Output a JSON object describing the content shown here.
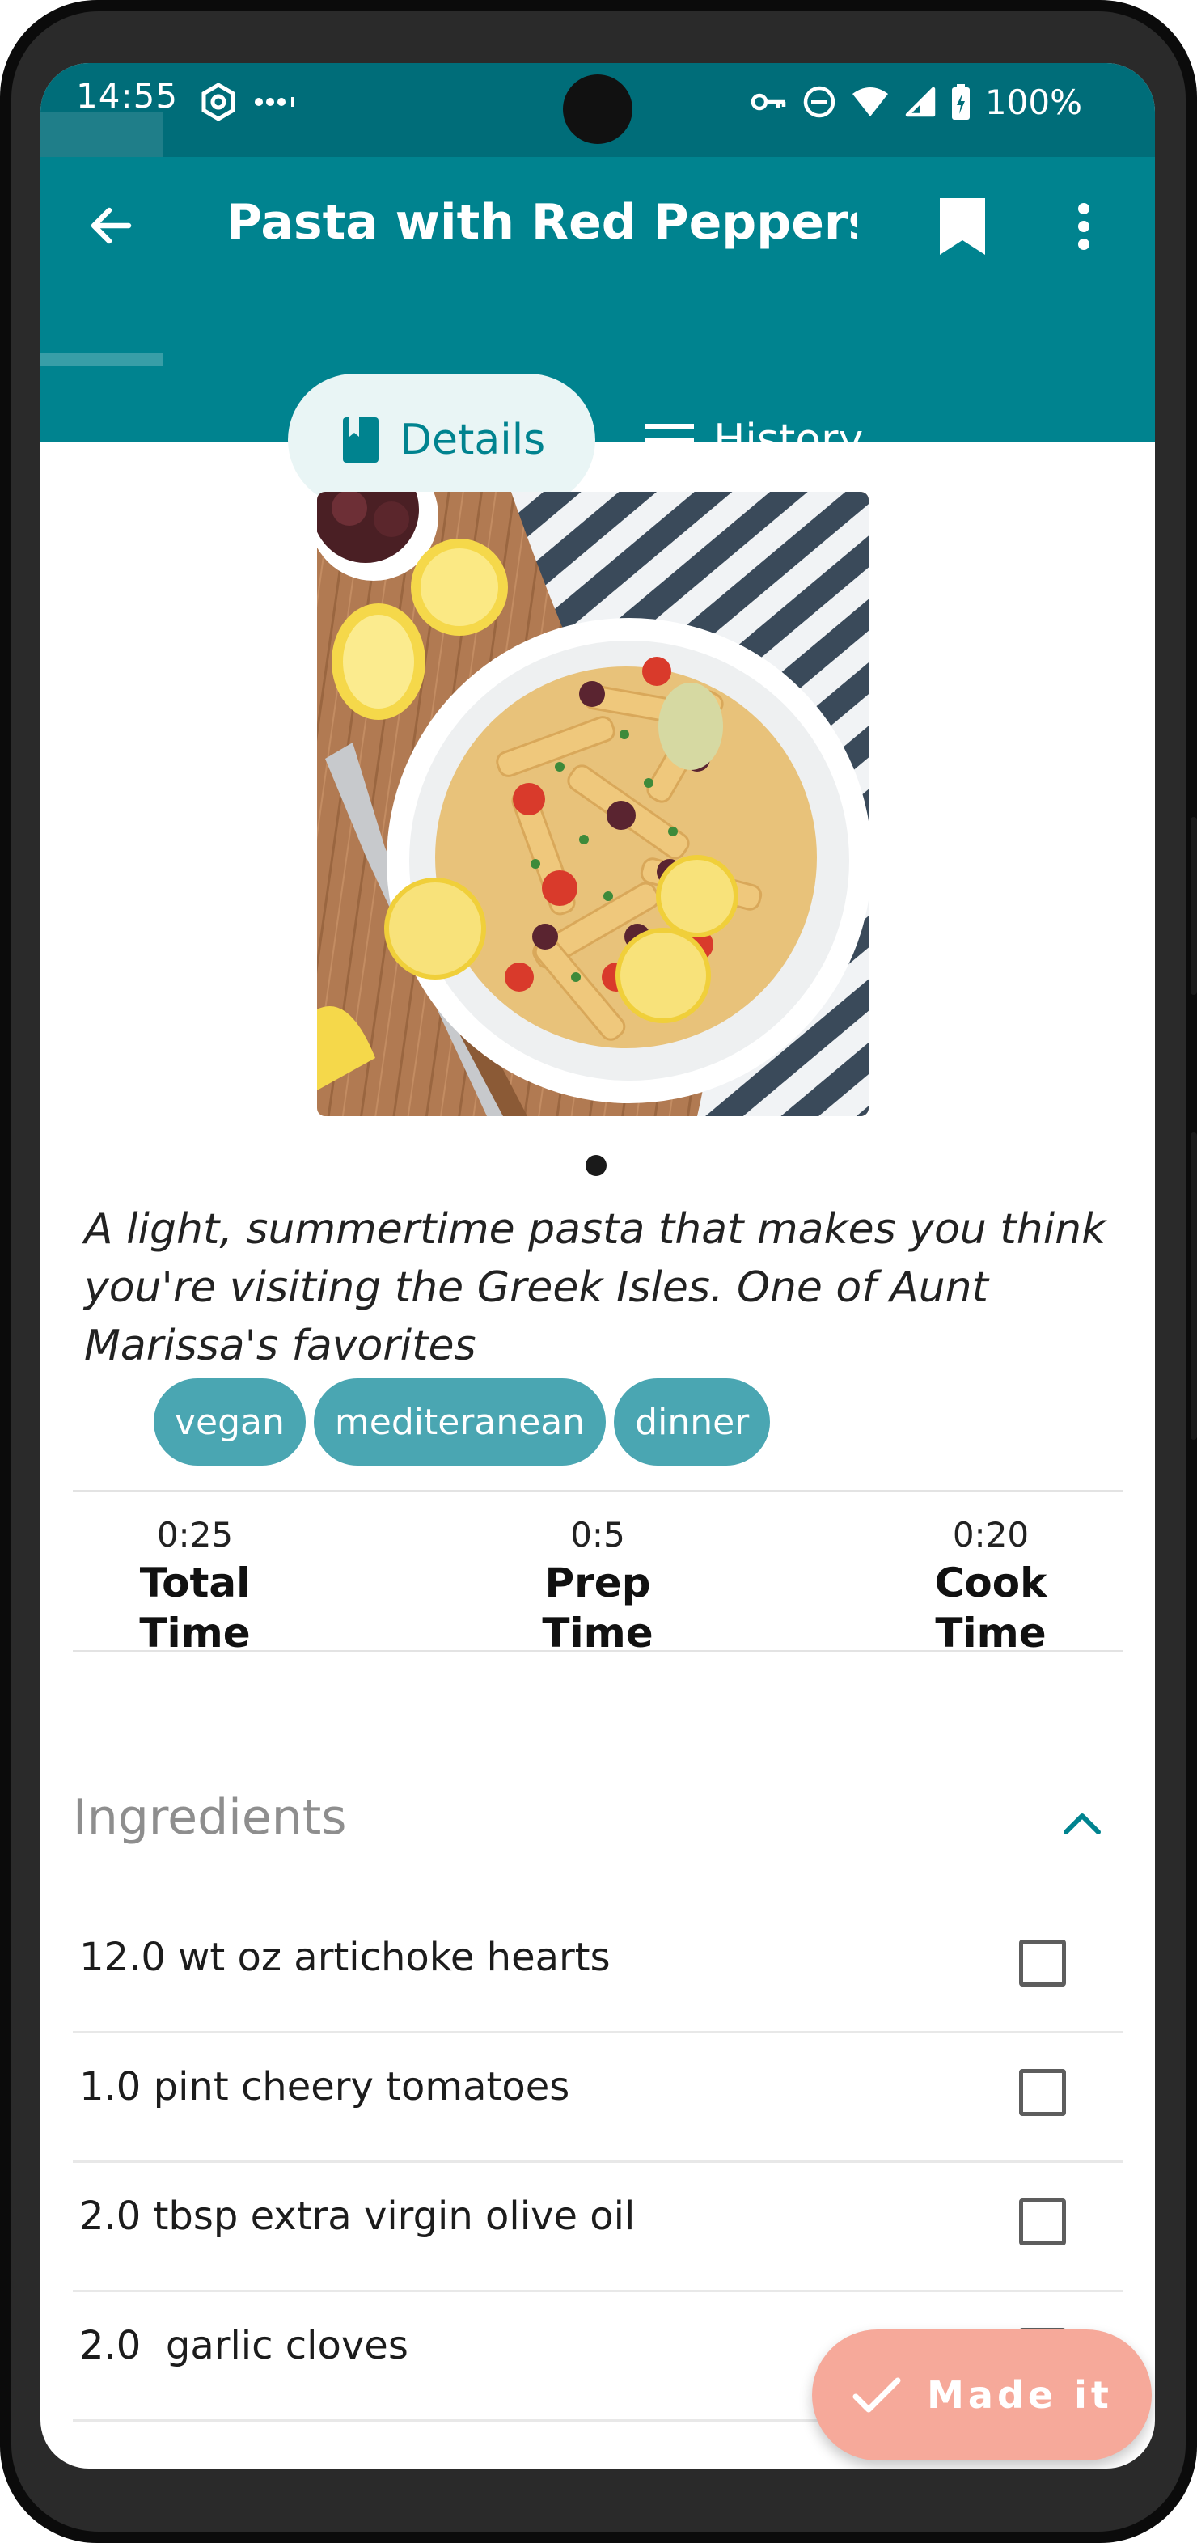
{
  "status_bar": {
    "time": "14:55",
    "battery": "100%"
  },
  "app_bar": {
    "title": "Pasta with Red Peppers…",
    "tabs": [
      {
        "label": "Details",
        "active": true
      },
      {
        "label": "History",
        "active": false
      }
    ]
  },
  "recipe": {
    "description": "A light, summertime pasta that makes you think you're visiting the Greek Isles. One of Aunt Marissa's favorites",
    "tags": [
      "vegan",
      "mediteranean",
      "dinner"
    ],
    "times": {
      "total_value": "0:25",
      "total_label": "Total Time",
      "prep_value": "0:5",
      "prep_label": "Prep Time",
      "cook_value": "0:20",
      "cook_label": "Cook Time"
    }
  },
  "ingredients": {
    "title": "Ingredients",
    "items": [
      "12.0 wt oz artichoke hearts",
      "1.0 pint cheery tomatoes",
      "2.0 tbsp extra virgin olive oil",
      "2.0  garlic cloves"
    ]
  },
  "fab": {
    "label": "Made it"
  },
  "colors": {
    "status_bar": "#006d79",
    "app_bar": "#00838f",
    "tag": "#4aa6b2",
    "fab": "#f6a99a"
  }
}
